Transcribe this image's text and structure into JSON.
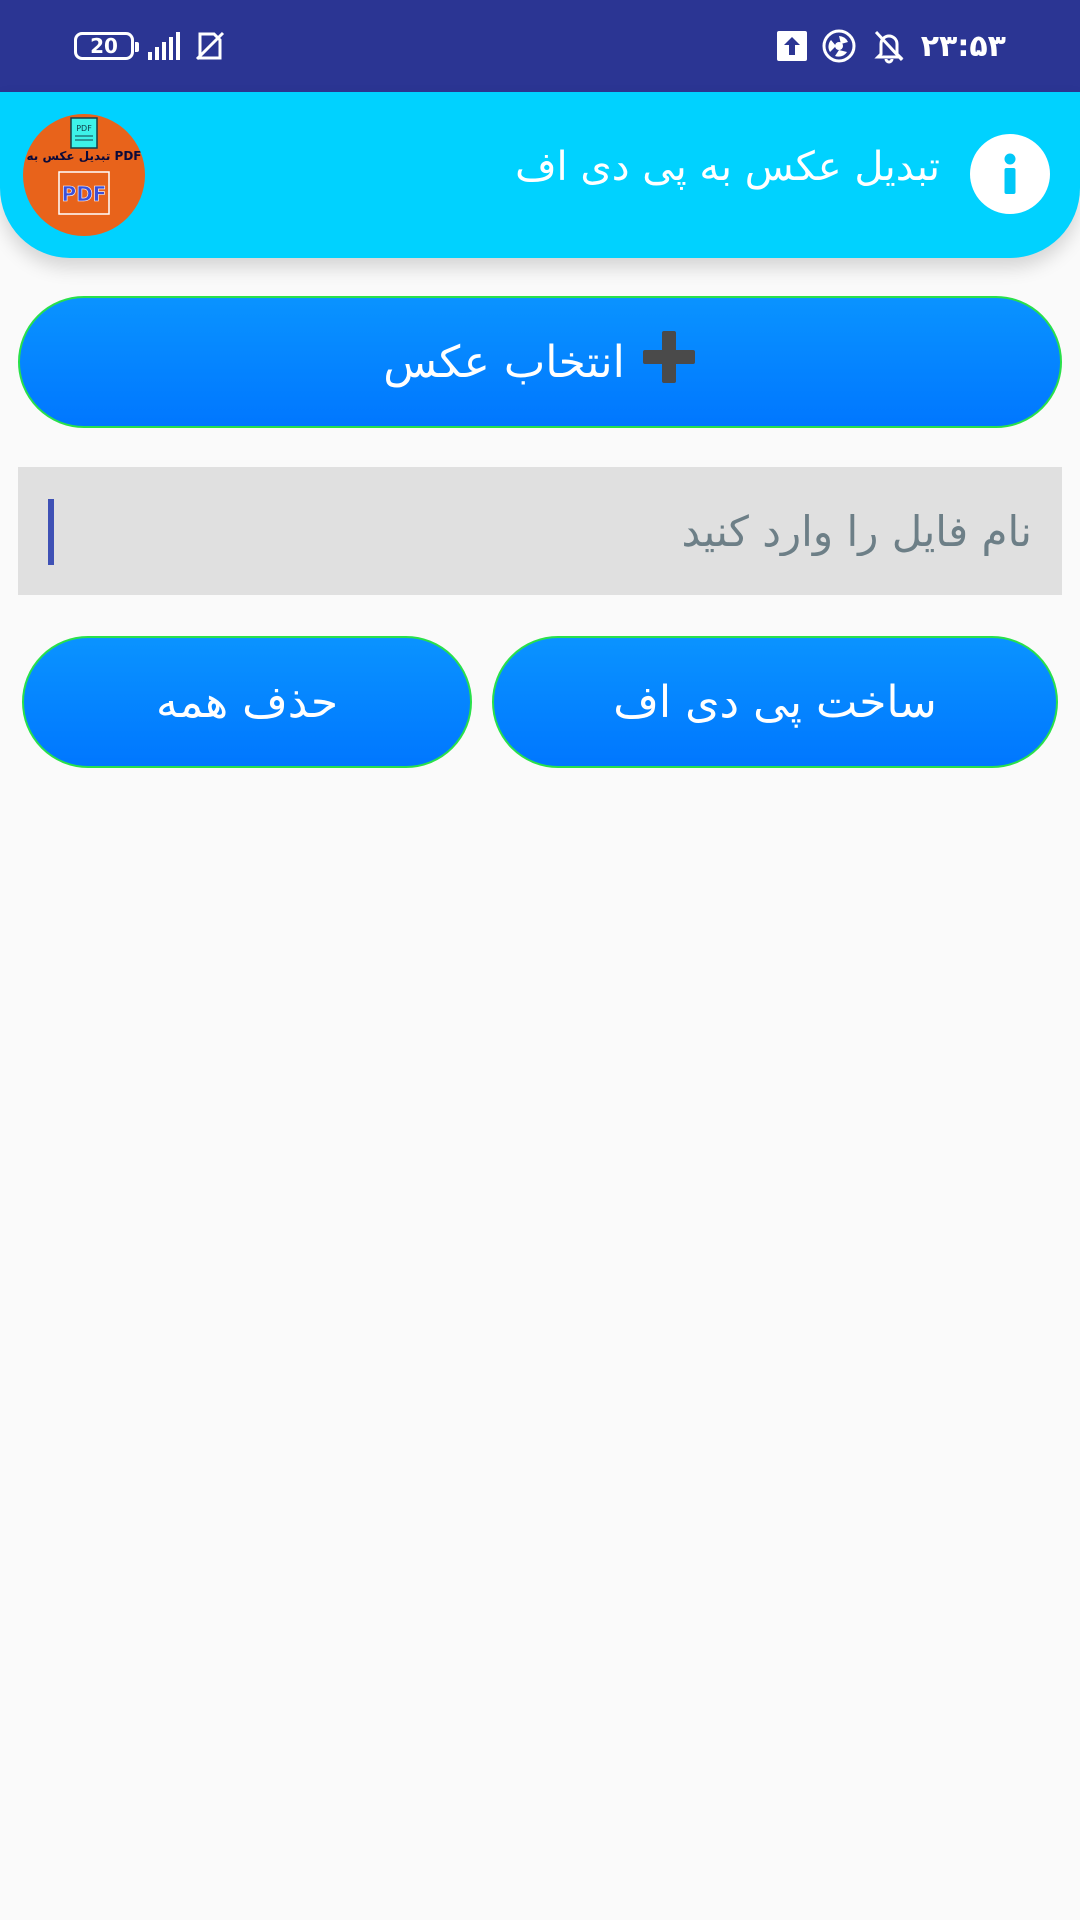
{
  "status_bar": {
    "time": "۲۳:۵۳",
    "battery": "20",
    "icons": [
      "upload-icon",
      "data-saver-icon",
      "alarm-off-icon",
      "no-sim-icon",
      "signal-icon",
      "battery-icon"
    ]
  },
  "app_bar": {
    "title": "تبدیل عکس به پی دی اف",
    "logo_text": "تبدیل عکس به PDF",
    "logo_badge": "PDF",
    "logo_file_label": "PDF",
    "info_icon": "info-icon"
  },
  "actions": {
    "select_image_label": "انتخاب عکس",
    "select_image_icon": "plus-icon",
    "create_pdf_label": "ساخت پی دی اف",
    "delete_all_label": "حذف همه"
  },
  "filename": {
    "placeholder": "نام فایل را وارد کنید",
    "value": ""
  },
  "colors": {
    "status_bar": "#2b3593",
    "app_bar": "#00d2ff",
    "button_top": "#0a93ff",
    "button_bottom": "#0077ff",
    "button_border": "#29e04a",
    "input_bg": "#e0e0e0",
    "caret": "#3f51b5",
    "logo_bg": "#e8631b"
  }
}
